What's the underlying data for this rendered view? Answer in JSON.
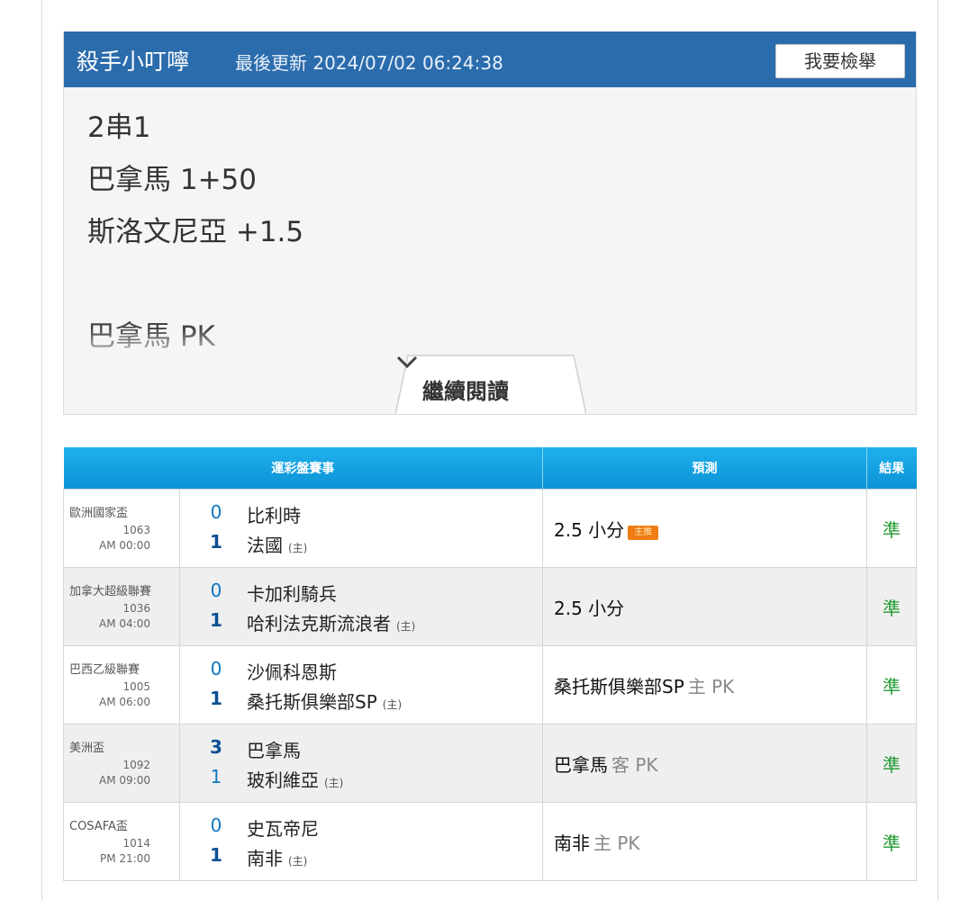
{
  "post": {
    "author": "殺手小叮嚀",
    "updated": "最後更新 2024/07/02 06:24:38",
    "report_button": "我要檢舉",
    "lines": [
      "2串1",
      "巴拿馬 1+50",
      "斯洛文尼亞 +1.5",
      "",
      "巴拿馬 PK"
    ],
    "read_more": "繼續閱讀"
  },
  "table": {
    "headers": [
      "運彩盤賽事",
      "預測",
      "結果"
    ],
    "rows": [
      {
        "league": "歐洲國家盃",
        "no": "1063",
        "time": "AM 00:00",
        "score1": "0",
        "team1": "比利時",
        "score2": "1",
        "team2": "法國",
        "home": "(主)",
        "pred": "2.5 小分",
        "pred_side": "",
        "badge": "主推",
        "result": "準"
      },
      {
        "league": "加拿大超級聯賽",
        "no": "1036",
        "time": "AM 04:00",
        "score1": "0",
        "team1": "卡加利騎兵",
        "score2": "1",
        "team2": "哈利法克斯流浪者",
        "home": "(主)",
        "pred": "2.5 小分",
        "pred_side": "",
        "badge": "",
        "result": "準"
      },
      {
        "league": "巴西乙級聯賽",
        "no": "1005",
        "time": "AM 06:00",
        "score1": "0",
        "team1": "沙佩科恩斯",
        "score2": "1",
        "team2": "桑托斯俱樂部SP",
        "home": "(主)",
        "pred": "桑托斯俱樂部SP",
        "pred_side": "主 PK",
        "badge": "",
        "result": "準"
      },
      {
        "league": "美洲盃",
        "no": "1092",
        "time": "AM 09:00",
        "score1": "3",
        "team1": "巴拿馬",
        "score2": "1",
        "team2": "玻利維亞",
        "home": "(主)",
        "pred": "巴拿馬",
        "pred_side": "客 PK",
        "badge": "",
        "result": "準"
      },
      {
        "league": "COSAFA盃",
        "no": "1014",
        "time": "PM 21:00",
        "score1": "0",
        "team1": "史瓦帝尼",
        "score2": "1",
        "team2": "南非",
        "home": "(主)",
        "pred": "南非",
        "pred_side": "主 PK",
        "badge": "",
        "result": "準"
      }
    ]
  }
}
